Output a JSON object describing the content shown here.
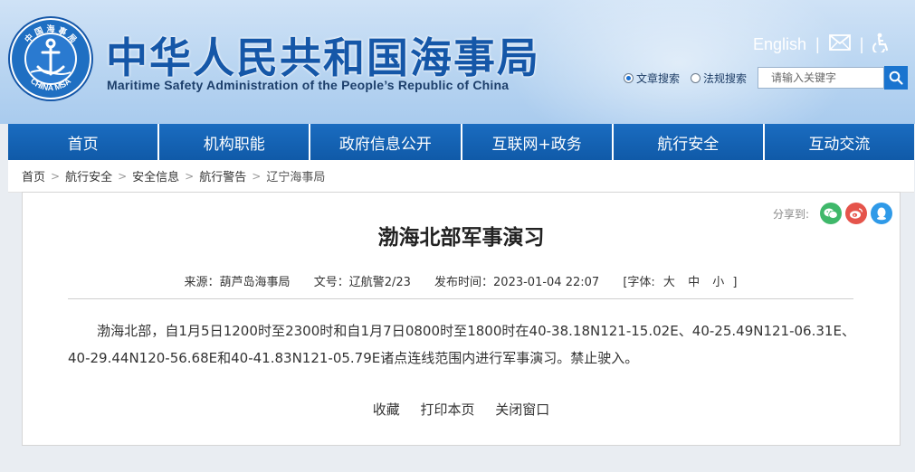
{
  "header": {
    "title_cn": "中华人民共和国海事局",
    "title_en": "Maritime Safety Administration of the People’s Republic of China",
    "logo_text_top": "中 国 海 事 局",
    "logo_text_bottom": "CHINA MSA",
    "english_link": "English",
    "separator": "|",
    "search": {
      "options": [
        "文章搜索",
        "法规搜索"
      ],
      "selected": "文章搜索",
      "placeholder": "请输入关键字"
    }
  },
  "nav": {
    "items": [
      "首页",
      "机构职能",
      "政府信息公开",
      "互联网+政务",
      "航行安全",
      "互动交流"
    ]
  },
  "breadcrumb": {
    "items": [
      "首页",
      "航行安全",
      "安全信息",
      "航行警告",
      "辽宁海事局"
    ],
    "separator": ">"
  },
  "article": {
    "share_label": "分享到:",
    "title": "渤海北部军事演习",
    "meta": {
      "source": "来源：葫芦岛海事局",
      "doc_no": "文号：辽航警2/23",
      "published": "发布时间：2023-01-04 22:07",
      "font_label_open": "[字体:",
      "font_large": "大",
      "font_medium": "中",
      "font_small": "小",
      "font_label_close": "]"
    },
    "body": "渤海北部，自1月5日1200时至2300时和自1月7日0800时至1800时在40-38.18N121-15.02E、40-25.49N121-06.31E、40-29.44N120-56.68E和40-41.83N121-05.79E诸点连线范围内进行军事演习。禁止驶入。",
    "actions": [
      "收藏",
      "打印本页",
      "关闭窗口"
    ]
  },
  "colors": {
    "brand_blue": "#1563b3",
    "title_blue": "#1557a8",
    "wechat_green": "#3fb86a",
    "weibo_red": "#e5544b",
    "qq_blue": "#2f9ae8"
  }
}
